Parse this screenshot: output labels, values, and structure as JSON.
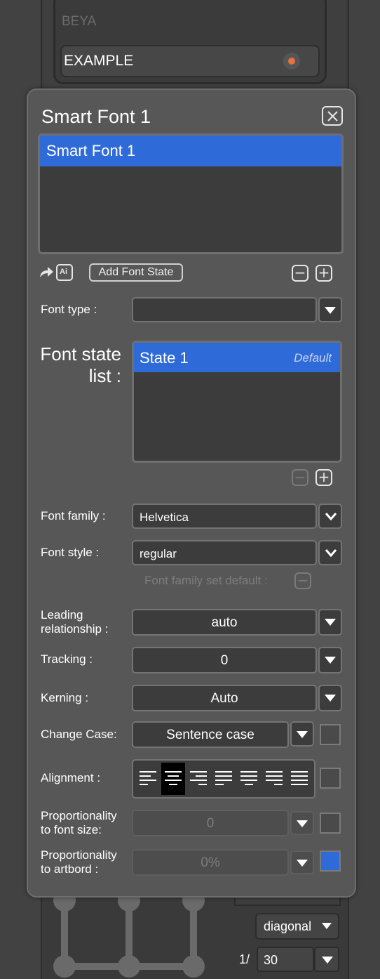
{
  "background": {
    "preview_label": "BEYA",
    "example_value": "EXAMPLE",
    "direction_select": "diagonal",
    "page_prefix": "1/",
    "page_value": "30"
  },
  "dialog": {
    "title": "Smart Font 1",
    "font_list": [
      "Smart Font 1"
    ],
    "toolbar": {
      "add_font_state_label": "Add Font State",
      "remove_symbol": "−",
      "add_symbol": "+"
    },
    "font_type": {
      "label": "Font type :",
      "value": ""
    },
    "font_state_list": {
      "label": "Font state list :",
      "items": [
        {
          "name": "State 1",
          "tag": "Default"
        }
      ]
    },
    "font_family": {
      "label": "Font family :",
      "value": "Helvetica"
    },
    "font_style": {
      "label": "Font style :",
      "value": "regular"
    },
    "family_default": {
      "label": "Font family set default :"
    },
    "leading": {
      "label": "Leading relationship :",
      "value": "auto"
    },
    "tracking": {
      "label": "Tracking :",
      "value": "0"
    },
    "kerning": {
      "label": "Kerning :",
      "value": "Auto"
    },
    "change_case": {
      "label": "Change Case:",
      "value": "Sentence case"
    },
    "alignment": {
      "label": "Alignment :",
      "selected": "align-center"
    },
    "prop_font_size": {
      "label": "Proportionality to font size:",
      "value": "0",
      "checked": false
    },
    "prop_artboard": {
      "label": "Proportionality to artbord :",
      "value": "0%",
      "checked": true
    }
  },
  "colors": {
    "accent": "#2f6bd8",
    "record_dot": "#e8713f"
  }
}
